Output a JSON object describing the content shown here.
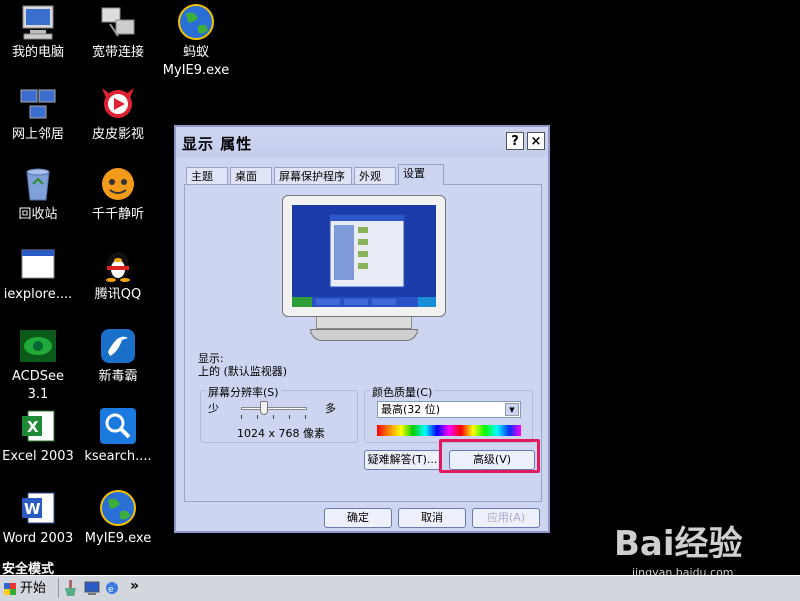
{
  "desktop": {
    "icons": [
      {
        "label": "我的电脑",
        "icon": "computer-icon"
      },
      {
        "label": "宽带连接",
        "icon": "network-connection-icon"
      },
      {
        "label_line1": "蚂蚁",
        "label_line2": "MyIE9.exe",
        "icon": "globe-icon"
      },
      {
        "label": "网上邻居",
        "icon": "network-places-icon"
      },
      {
        "label": "皮皮影视",
        "icon": "media-player-icon"
      },
      {
        "label": "回收站",
        "icon": "recycle-bin-icon"
      },
      {
        "label": "千千静听",
        "icon": "music-player-icon"
      },
      {
        "label": "iexplore....",
        "icon": "window-icon"
      },
      {
        "label": "腾讯QQ",
        "icon": "qq-penguin-icon"
      },
      {
        "label_line1": "ACDSee",
        "label_line2": "3.1",
        "icon": "eye-icon"
      },
      {
        "label": "新毒霸",
        "icon": "antivirus-icon"
      },
      {
        "label": "Excel 2003",
        "icon": "excel-icon"
      },
      {
        "label": "ksearch....",
        "icon": "search-icon"
      },
      {
        "label": "Word 2003",
        "icon": "word-icon"
      },
      {
        "label": "MyIE9.exe",
        "icon": "globe-icon"
      }
    ],
    "safe_mode": "安全模式"
  },
  "dialog": {
    "title": "显示 属性",
    "help_button": "?",
    "close_button": "×",
    "tabs": [
      {
        "label": "主题"
      },
      {
        "label": "桌面"
      },
      {
        "label": "屏幕保护程序"
      },
      {
        "label": "外观"
      },
      {
        "label": "设置",
        "active": true
      }
    ],
    "display_label": "显示:",
    "display_value": "上的 (默认监视器)",
    "resolution": {
      "title": "屏幕分辨率(S)",
      "min_label": "少",
      "max_label": "多",
      "value": "1024 x 768 像素",
      "slider_level": 0.35
    },
    "color_quality": {
      "title": "颜色质量(C)",
      "selected": "最高(32 位)"
    },
    "troubleshoot_button": "疑难解答(T)...",
    "advanced_button": "高级(V)",
    "ok_button": "确定",
    "cancel_button": "取消",
    "apply_button": "应用(A)",
    "colors": {
      "highlight": "#e01a5c",
      "dialog_bg": "#ced5f0"
    }
  },
  "taskbar": {
    "start_label": "开始",
    "overflow": "»"
  },
  "watermark": {
    "logo": "Bai经验",
    "url": "jingyan.baidu.com"
  }
}
